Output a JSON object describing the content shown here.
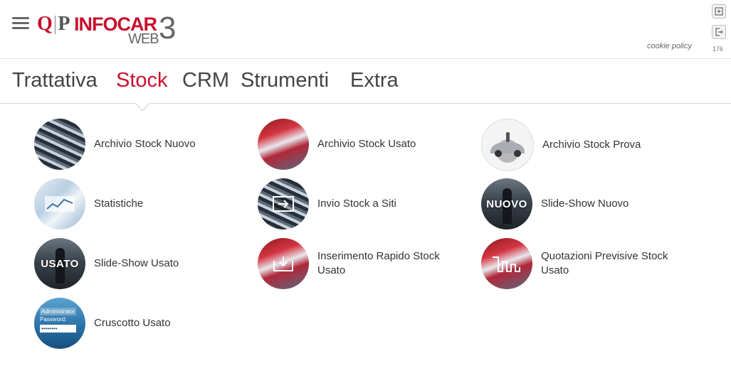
{
  "header": {
    "logo": {
      "qp": "Q",
      "qp2": "P",
      "brand": "INFOCAR",
      "web": "WEB",
      "version": "3"
    },
    "cookie_policy": "cookie policy",
    "counter": "176"
  },
  "tabs": [
    {
      "label": "Trattativa",
      "active": false
    },
    {
      "label": "Stock",
      "active": true
    },
    {
      "label": "CRM",
      "active": false
    },
    {
      "label": "Strumenti",
      "active": false
    },
    {
      "label": "Extra",
      "active": false
    }
  ],
  "menu": [
    {
      "label": "Archivio Stock Nuovo",
      "icon": "parked-cars-thumb"
    },
    {
      "label": "Archivio Stock Usato",
      "icon": "red-cars-thumb"
    },
    {
      "label": "Archivio Stock Prova",
      "icon": "car-keys-thumb"
    },
    {
      "label": "Statistiche",
      "icon": "statistics-thumb"
    },
    {
      "label": "Invio Stock a Siti",
      "icon": "send-to-sites-thumb"
    },
    {
      "label": "Slide-Show Nuovo",
      "icon": "slideshow-new-thumb",
      "overlay": "NUOVO"
    },
    {
      "label": "Slide-Show Usato",
      "icon": "slideshow-used-thumb",
      "overlay": "USATO"
    },
    {
      "label": "Inserimento Rapido Stock Usato",
      "icon": "quick-insert-thumb"
    },
    {
      "label": "Quotazioni Previsive Stock Usato",
      "icon": "price-forecast-thumb"
    },
    {
      "label": "Cruscotto Usato",
      "icon": "admin-login-thumb",
      "overlay_lines": [
        "Administrator",
        "Password:",
        "••••••••"
      ]
    }
  ],
  "colors": {
    "accent": "#c8102e",
    "text": "#333333",
    "muted": "#666666"
  }
}
